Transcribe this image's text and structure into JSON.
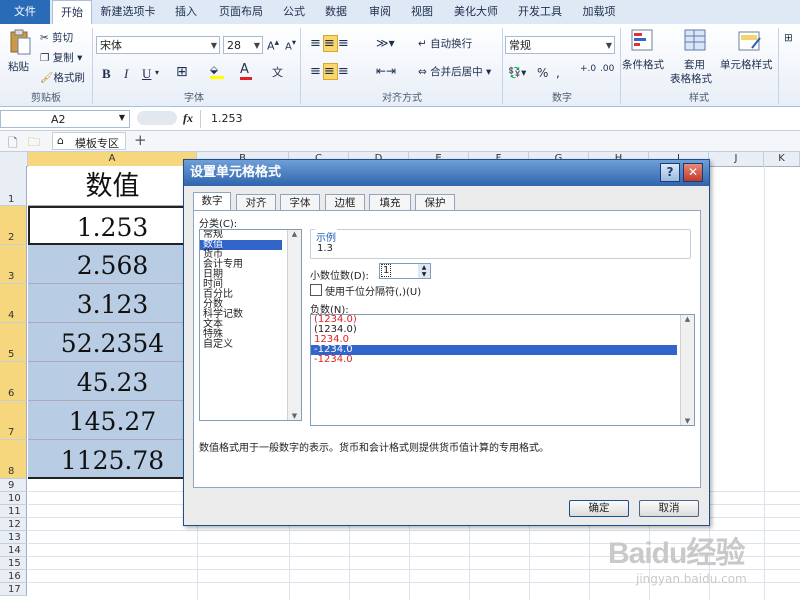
{
  "ribbon_tabs": [
    "文件",
    "开始",
    "新建选项卡",
    "插入",
    "页面布局",
    "公式",
    "数据",
    "审阅",
    "视图",
    "美化大师",
    "开发工具",
    "加载项"
  ],
  "clipboard": {
    "paste": "粘贴",
    "cut": "剪切",
    "copy": "复制",
    "format_painter": "格式刷",
    "group": "剪贴板"
  },
  "font": {
    "name": "宋体",
    "size": "28",
    "group": "字体",
    "bold": "B",
    "italic": "I",
    "underline": "U"
  },
  "alignment": {
    "wrap": "自动换行",
    "merge": "合并后居中",
    "group": "对齐方式"
  },
  "number": {
    "format": "常规",
    "percent": "%",
    "comma": ",",
    "group": "数字"
  },
  "styles": {
    "conditional": "条件格式",
    "table_1": "套用",
    "table_2": "表格格式",
    "cell_styles": "单元格样式",
    "group": "样式"
  },
  "formula_bar": {
    "name_box": "A2",
    "fx": "fx",
    "value": "1.253"
  },
  "template_bar": {
    "label": "模板专区",
    "add": "+"
  },
  "columns": [
    "A",
    "B",
    "C",
    "D",
    "E",
    "F",
    "G",
    "H",
    "I",
    "J",
    "K"
  ],
  "rows": [
    "1",
    "2",
    "3",
    "4",
    "5",
    "6",
    "7",
    "8",
    "9",
    "10",
    "11",
    "12",
    "13",
    "14",
    "15",
    "16",
    "17"
  ],
  "cells": [
    "数值",
    "1.253",
    "2.568",
    "3.123",
    "52.2354",
    "45.23",
    "145.27",
    "1125.78"
  ],
  "dialog": {
    "title": "设置单元格格式",
    "help": "?",
    "close": "✕",
    "tabs": [
      "数字",
      "对齐",
      "字体",
      "边框",
      "填充",
      "保护"
    ],
    "category_label": "分类(C):",
    "categories": [
      "常规",
      "数值",
      "货币",
      "会计专用",
      "日期",
      "时间",
      "百分比",
      "分数",
      "科学记数",
      "文本",
      "特殊",
      "自定义"
    ],
    "sample_label": "示例",
    "sample_value": "1.3",
    "decimal_label": "小数位数(D):",
    "decimal_value": "1",
    "thousands_label": "使用千位分隔符(,)(U)",
    "negative_label": "负数(N):",
    "negatives": [
      "(1234.0)",
      "(1234.0)",
      "1234.0",
      "-1234.0",
      "-1234.0"
    ],
    "description": "数值格式用于一般数字的表示。货币和会计格式则提供货币值计算的专用格式。",
    "ok": "确定",
    "cancel": "取消"
  },
  "watermark": {
    "brand": "Baidu经验",
    "url": "jingyan.baidu.com"
  },
  "colors": {
    "selected_fill": "#b8cce4",
    "file_tab": "#2a6bb8",
    "title_bar": "#2f64ad",
    "selection": "#3165c9",
    "negative_red": "#e02020"
  }
}
